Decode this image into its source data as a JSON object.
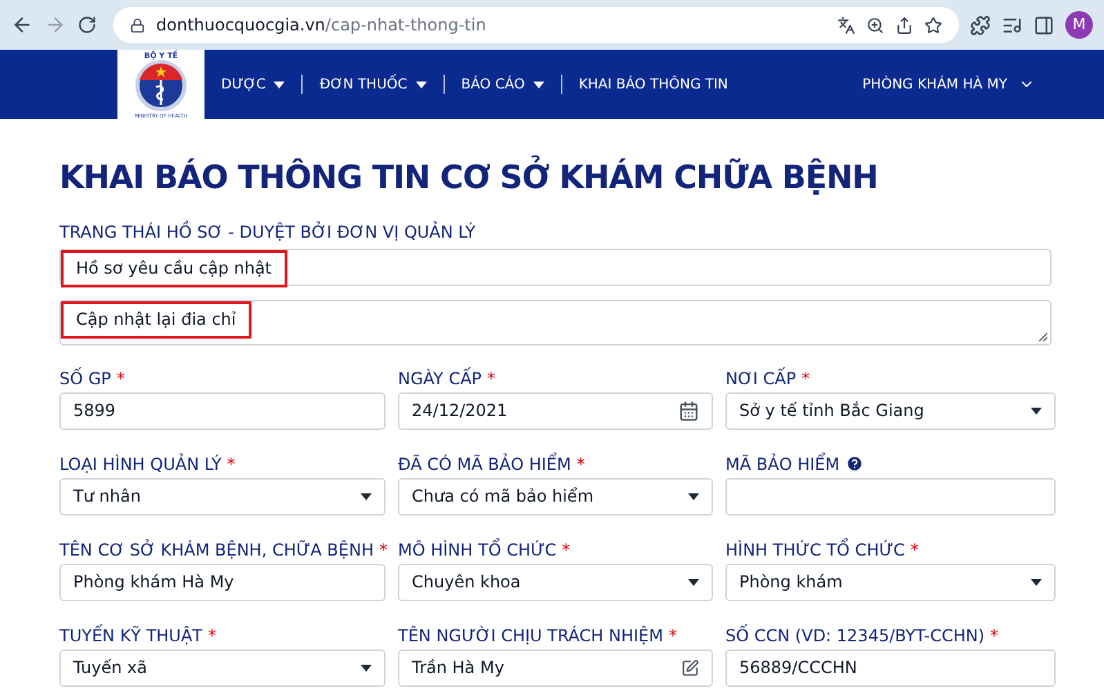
{
  "browser": {
    "url_domain": "donthuocquocgia.vn",
    "url_path": "/cap-nhat-thong-tin",
    "profile_initial": "M"
  },
  "logo": {
    "top_text": "BỘ Y TẾ",
    "bottom_text": "MINISTRY OF HEALTH"
  },
  "nav": {
    "items": [
      {
        "label": "DƯỢC",
        "dropdown": true
      },
      {
        "label": "ĐƠN THUỐC",
        "dropdown": true
      },
      {
        "label": "BÁO CÁO",
        "dropdown": true
      },
      {
        "label": "KHAI BÁO THÔNG TIN",
        "dropdown": false
      }
    ],
    "account": "PHÒNG KHÁM HÀ MY"
  },
  "page_title": "KHAI BÁO THÔNG TIN CƠ SỞ KHÁM CHỮA BỆNH",
  "status": {
    "label": "TRANG THÁI HỒ SƠ - DUYỆT BỞI ĐƠN VỊ QUẢN LÝ",
    "fields": [
      {
        "kind": "input",
        "value": "Hồ sơ yêu cầu cập nhật",
        "highlighted": true
      },
      {
        "kind": "textarea",
        "value": "Cập nhật lại đia chỉ",
        "highlighted": true
      }
    ]
  },
  "fields": [
    {
      "label": "SỐ GP",
      "required_mark": "*",
      "kind": "text",
      "value": "5899"
    },
    {
      "label": "NGÀY CẤP",
      "required_mark": "*",
      "kind": "date",
      "value": "24/12/2021"
    },
    {
      "label": "NƠI CẤP",
      "required_mark": "*",
      "kind": "select",
      "value": "Sở y tế tỉnh Bắc Giang"
    },
    {
      "label": "LOẠI HÌNH QUẢN LÝ",
      "required_mark": "*",
      "kind": "select",
      "value": "Tư nhân"
    },
    {
      "label": "ĐÃ CÓ MÃ BẢO HIỂM",
      "required_mark": "*",
      "kind": "select",
      "value": "Chưa có mã bảo hiểm"
    },
    {
      "label": "MÃ BẢO HIỂM",
      "kind": "help"
    },
    {
      "label": "TÊN CƠ SỞ KHÁM BỆNH, CHỮA BỆNH",
      "required_mark": "*",
      "kind": "text",
      "value": "Phòng khám Hà My"
    },
    {
      "label": "MÔ HÌNH TỔ CHỨC",
      "required_mark": "*",
      "kind": "select",
      "value": "Chuyên khoa"
    },
    {
      "label": "HÌNH THỨC TỔ CHỨC",
      "required_mark": "*",
      "kind": "select",
      "value": "Phòng khám"
    },
    {
      "label": "TUYẾN KỸ THUẬT",
      "required_mark": "*",
      "kind": "select",
      "value": "Tuyến xã"
    },
    {
      "label": "TÊN NGƯỜI CHỊU TRÁCH NHIỆM",
      "required_mark": "*",
      "kind": "edit",
      "value": "Trần Hà My"
    },
    {
      "label": "SỐ CCN (VD: 12345/BYT-CCHN)",
      "required_mark": "*",
      "kind": "text",
      "value": "56889/CCCHN"
    }
  ]
}
